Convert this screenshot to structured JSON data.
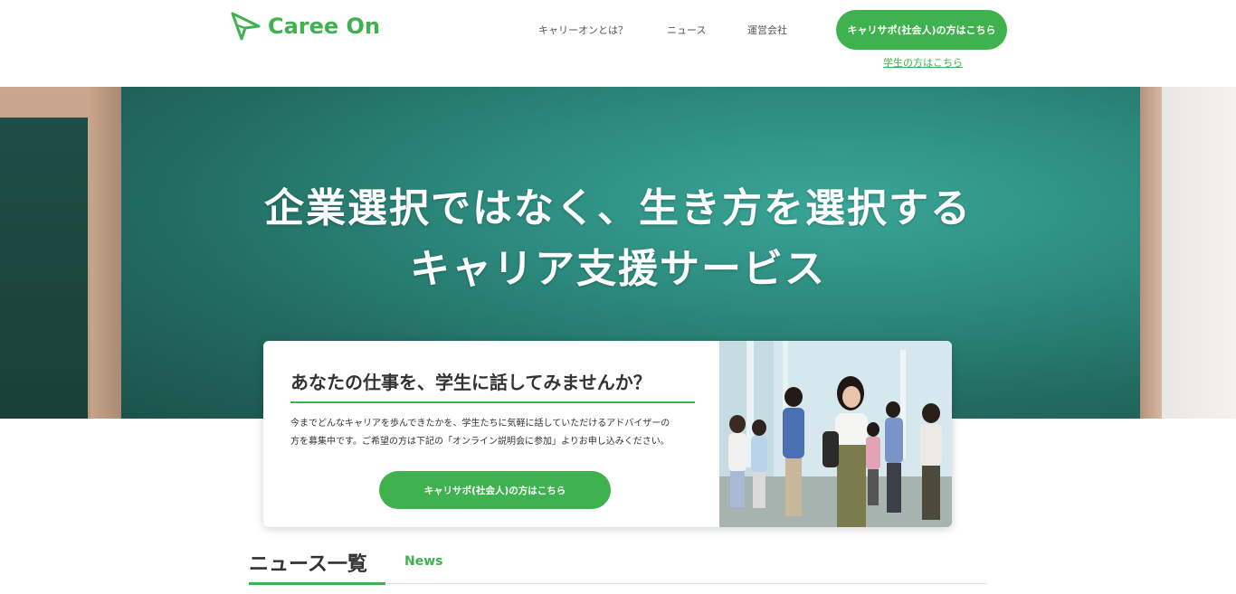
{
  "header": {
    "logo_text": "Caree On",
    "nav": [
      {
        "label": "キャリーオンとは？"
      },
      {
        "label": "ニュース"
      },
      {
        "label": "運営会社"
      }
    ],
    "cta_label": "キャリサポ(社会人)の方はこちら",
    "student_link": "学生の方はこちら"
  },
  "hero": {
    "title_line1": "企業選択ではなく、生き方を選択する",
    "title_line2": "キャリア支援サービス"
  },
  "card": {
    "heading": "あなたの仕事を、学生に話してみませんか？",
    "body_line1": "今までどんなキャリアを歩んできたかを、学生たちに気軽に話していただけるアドバイザーの",
    "body_line2": "方を募集中です。ご希望の方は下記の「オンライン説明会に参加」よりお申し込みください。",
    "button_label": "キャリサポ(社会人)の方はこちら"
  },
  "news": {
    "title": "ニュース一覧",
    "title_en": "News"
  },
  "colors": {
    "accent": "#3fb24f",
    "chalkboard": "#2c8a7d",
    "text": "#333333"
  }
}
